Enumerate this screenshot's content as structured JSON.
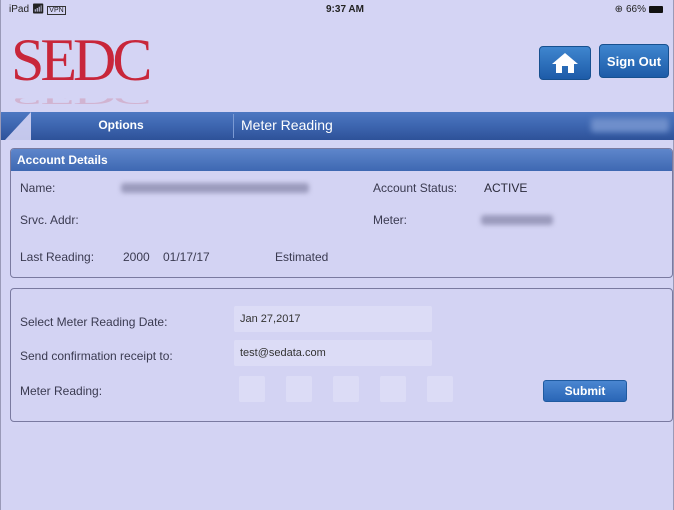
{
  "status_bar": {
    "carrier": "iPad",
    "vpn": "VPN",
    "time": "9:37 AM",
    "battery_pct": "66%"
  },
  "logo": {
    "text": "SEDC"
  },
  "header": {
    "home_icon": "home-icon",
    "sign_out_label": "Sign Out"
  },
  "nav": {
    "options_label": "Options",
    "title": "Meter Reading"
  },
  "account": {
    "header": "Account Details",
    "name_label": "Name:",
    "status_label": "Account Status:",
    "status_value": "ACTIVE",
    "srvc_addr_label": "Srvc. Addr:",
    "meter_label": "Meter:",
    "last_reading_label": "Last Reading:",
    "last_reading_value": "2000",
    "last_reading_date": "01/17/17",
    "last_reading_type": "Estimated"
  },
  "reading_form": {
    "date_label": "Select Meter Reading Date:",
    "date_value": "Jan 27,2017",
    "receipt_label": "Send confirmation receipt to:",
    "receipt_value": "test@sedata.com",
    "meter_reading_label": "Meter Reading:",
    "submit_label": "Submit"
  },
  "colors": {
    "background": "#d4d4f4",
    "accent_blue": "#2e5299",
    "logo_red": "#c8263a"
  }
}
